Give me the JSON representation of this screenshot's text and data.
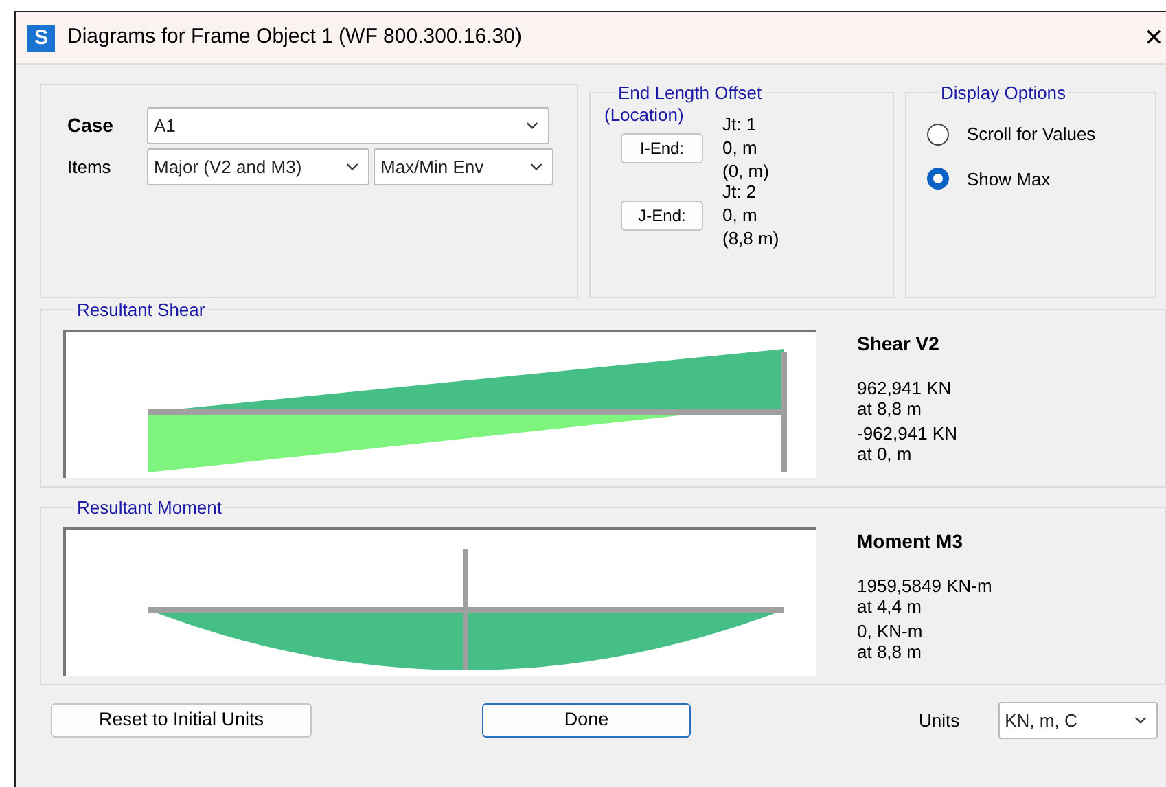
{
  "window": {
    "icon_letter": "S",
    "title": "Diagrams for Frame Object 1  (WF 800.300.16.30)",
    "close": "✕"
  },
  "case": {
    "label": "Case",
    "value": "A1"
  },
  "items": {
    "label": "Items",
    "component": "Major (V2 and M3)",
    "envelope": "Max/Min Env"
  },
  "end_length_offset": {
    "title": "End Length Offset",
    "subtitle": "(Location)",
    "ends": [
      {
        "button": "I-End:",
        "joint": "Jt:  1",
        "offset": "0, m",
        "location": "(0, m)"
      },
      {
        "button": "J-End:",
        "joint": "Jt:  2",
        "offset": "0, m",
        "location": "(8,8 m)"
      }
    ]
  },
  "display_options": {
    "title": "Display Options",
    "options": [
      {
        "label": "Scroll for Values",
        "selected": false
      },
      {
        "label": "Show Max",
        "selected": true
      }
    ]
  },
  "panels": [
    {
      "title": "Resultant Shear",
      "kind": "shear",
      "heading": "Shear V2",
      "results": [
        {
          "value": "962,941 KN",
          "at": "at 8,8 m"
        },
        {
          "value": "-962,941 KN",
          "at": "at 0, m"
        }
      ]
    },
    {
      "title": "Resultant Moment",
      "kind": "moment",
      "heading": "Moment M3",
      "results": [
        {
          "value": "1959,5849 KN-m",
          "at": "at 4,4 m"
        },
        {
          "value": "0, KN-m",
          "at": "at 8,8 m"
        }
      ]
    }
  ],
  "footer": {
    "reset": "Reset to Initial Units",
    "done": "Done",
    "units_label": "Units",
    "units": "KN, m, C"
  }
}
